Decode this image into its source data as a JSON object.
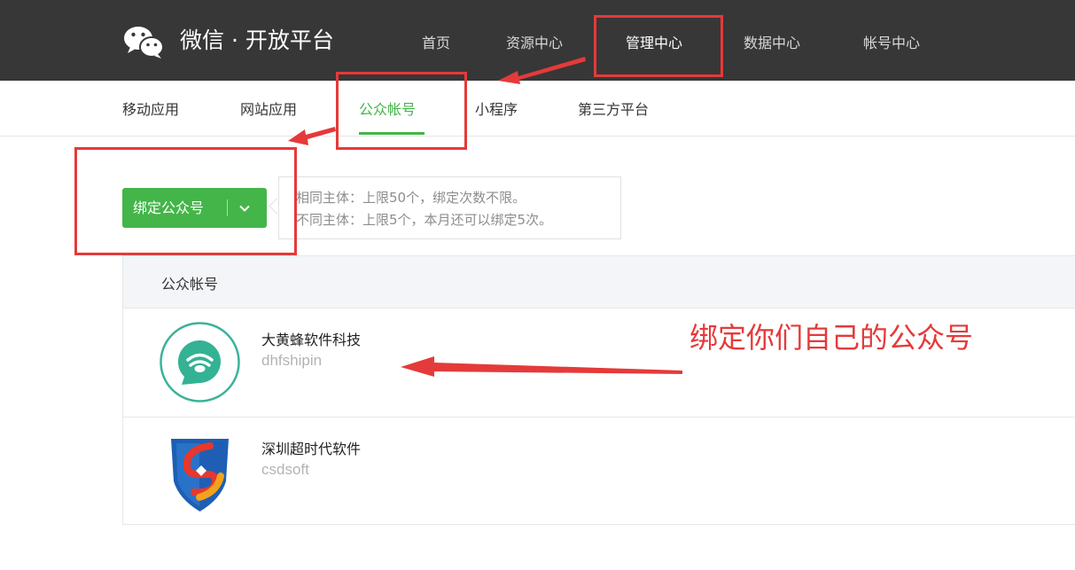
{
  "header": {
    "brand": "微信 · 开放平台",
    "nav": [
      {
        "label": "首页",
        "active": false
      },
      {
        "label": "资源中心",
        "active": false
      },
      {
        "label": "管理中心",
        "active": true
      },
      {
        "label": "数据中心",
        "active": false
      },
      {
        "label": "帐号中心",
        "active": false
      }
    ]
  },
  "subnav": {
    "items": [
      {
        "label": "移动应用",
        "active": false
      },
      {
        "label": "网站应用",
        "active": false
      },
      {
        "label": "公众帐号",
        "active": true
      },
      {
        "label": "小程序",
        "active": false
      },
      {
        "label": "第三方平台",
        "active": false
      }
    ]
  },
  "bind": {
    "button_label": "绑定公众号",
    "tips": [
      "相同主体：上限50个，绑定次数不限。",
      "不同主体：上限5个，本月还可以绑定5次。"
    ]
  },
  "table": {
    "header": "公众帐号",
    "rows": [
      {
        "name": "大黄蜂软件科技",
        "id": "dhfshipin"
      },
      {
        "name": "深圳超时代软件",
        "id": "csdsoft"
      }
    ]
  },
  "annotation": {
    "text": "绑定你们自己的公众号",
    "color": "#e53a3a"
  },
  "colors": {
    "accent": "#44b549",
    "topbar": "#373737"
  }
}
